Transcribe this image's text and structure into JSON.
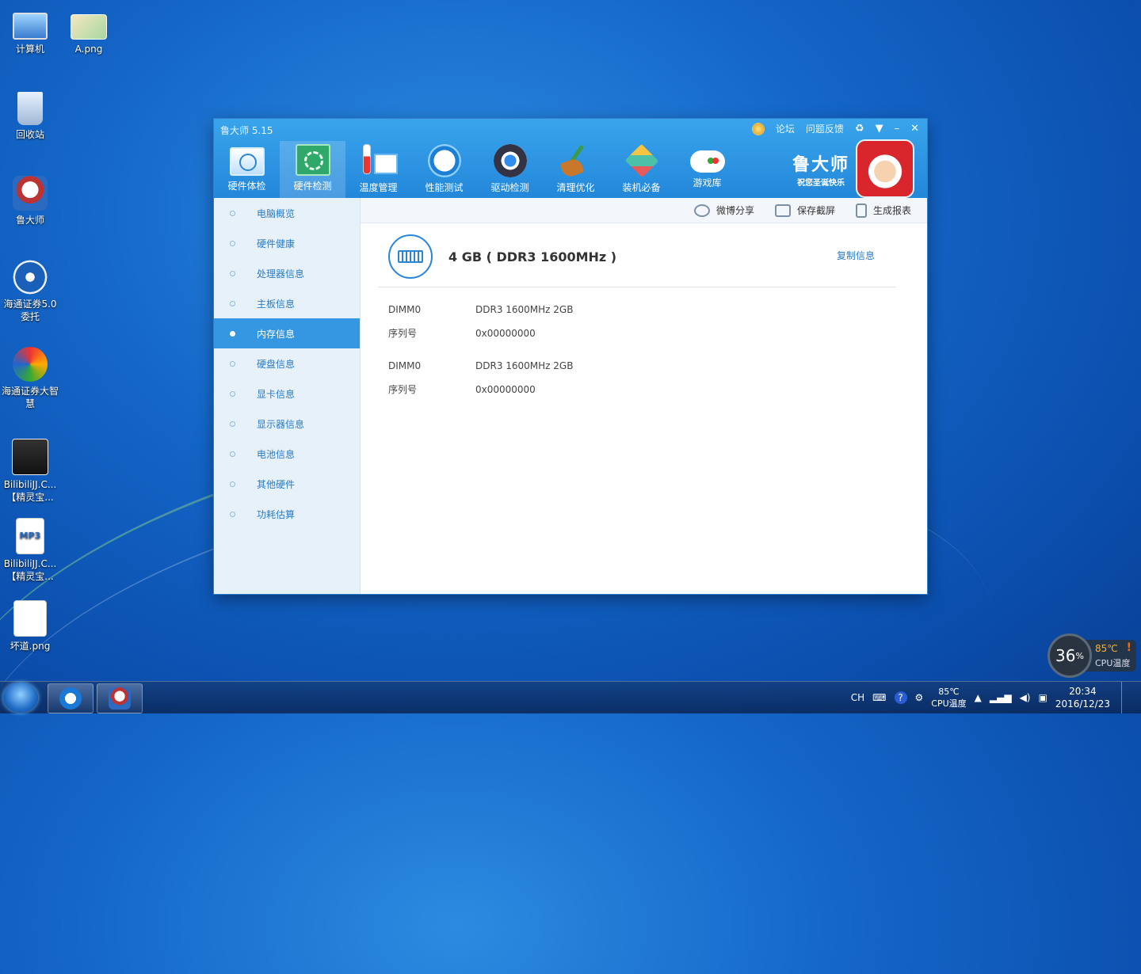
{
  "desktop": {
    "icons": [
      {
        "label": "计算机"
      },
      {
        "label": "A.png"
      },
      {
        "label": "回收站"
      },
      {
        "label": "鲁大师"
      },
      {
        "label": "海通证券5.0委托"
      },
      {
        "label": "海通证券大智慧"
      },
      {
        "label": "BilibiliJJ.C...【精灵宝..."
      },
      {
        "label": "BilibiliJJ.C...【精灵宝..."
      },
      {
        "label": "坏道.png"
      }
    ],
    "mp3_badge": "MP3"
  },
  "app": {
    "title": "鲁大师 5.15",
    "top_links": {
      "forum": "论坛",
      "feedback": "问题反馈"
    },
    "controls": {
      "skin": "♻",
      "menu": "▼",
      "minimize": "–",
      "close": "✕"
    },
    "nav": [
      {
        "label": "硬件体检",
        "icon": "hardware-check-icon"
      },
      {
        "label": "硬件检测",
        "icon": "hardware-detect-icon"
      },
      {
        "label": "温度管理",
        "icon": "temperature-icon"
      },
      {
        "label": "性能测试",
        "icon": "performance-icon"
      },
      {
        "label": "驱动检测",
        "icon": "driver-icon"
      },
      {
        "label": "清理优化",
        "icon": "broom-icon"
      },
      {
        "label": "装机必备",
        "icon": "essentials-icon"
      },
      {
        "label": "游戏库",
        "icon": "gamepad-icon"
      }
    ],
    "active_nav": 1,
    "brand": {
      "name": "鲁大师",
      "slogan": "祝您圣诞快乐"
    },
    "sidebar": [
      {
        "label": "电脑概览"
      },
      {
        "label": "硬件健康"
      },
      {
        "label": "处理器信息"
      },
      {
        "label": "主板信息"
      },
      {
        "label": "内存信息"
      },
      {
        "label": "硬盘信息"
      },
      {
        "label": "显卡信息"
      },
      {
        "label": "显示器信息"
      },
      {
        "label": "电池信息"
      },
      {
        "label": "其他硬件"
      },
      {
        "label": "功耗估算"
      }
    ],
    "active_sidebar": 4,
    "toolbar": {
      "weibo": "微博分享",
      "screenshot": "保存截屏",
      "report": "生成报表"
    },
    "memory": {
      "summary": "4 GB ( DDR3 1600MHz )",
      "copy_label": "复制信息",
      "modules": [
        {
          "slot_label": "DIMM0",
          "slot_value": "DDR3 1600MHz 2GB",
          "serial_label": "序列号",
          "serial_value": "0x00000000"
        },
        {
          "slot_label": "DIMM0",
          "slot_value": "DDR3 1600MHz 2GB",
          "serial_label": "序列号",
          "serial_value": "0x00000000"
        }
      ]
    }
  },
  "cpu_widget": {
    "usage": "36",
    "usage_unit": "%",
    "temp": "85℃",
    "warn": "!",
    "label": "CPU温度"
  },
  "taskbar": {
    "lang": "CH",
    "help": "?",
    "cpu_temp": "85℃",
    "cpu_label": "CPU温度",
    "time": "20:34",
    "date": "2016/12/23"
  }
}
